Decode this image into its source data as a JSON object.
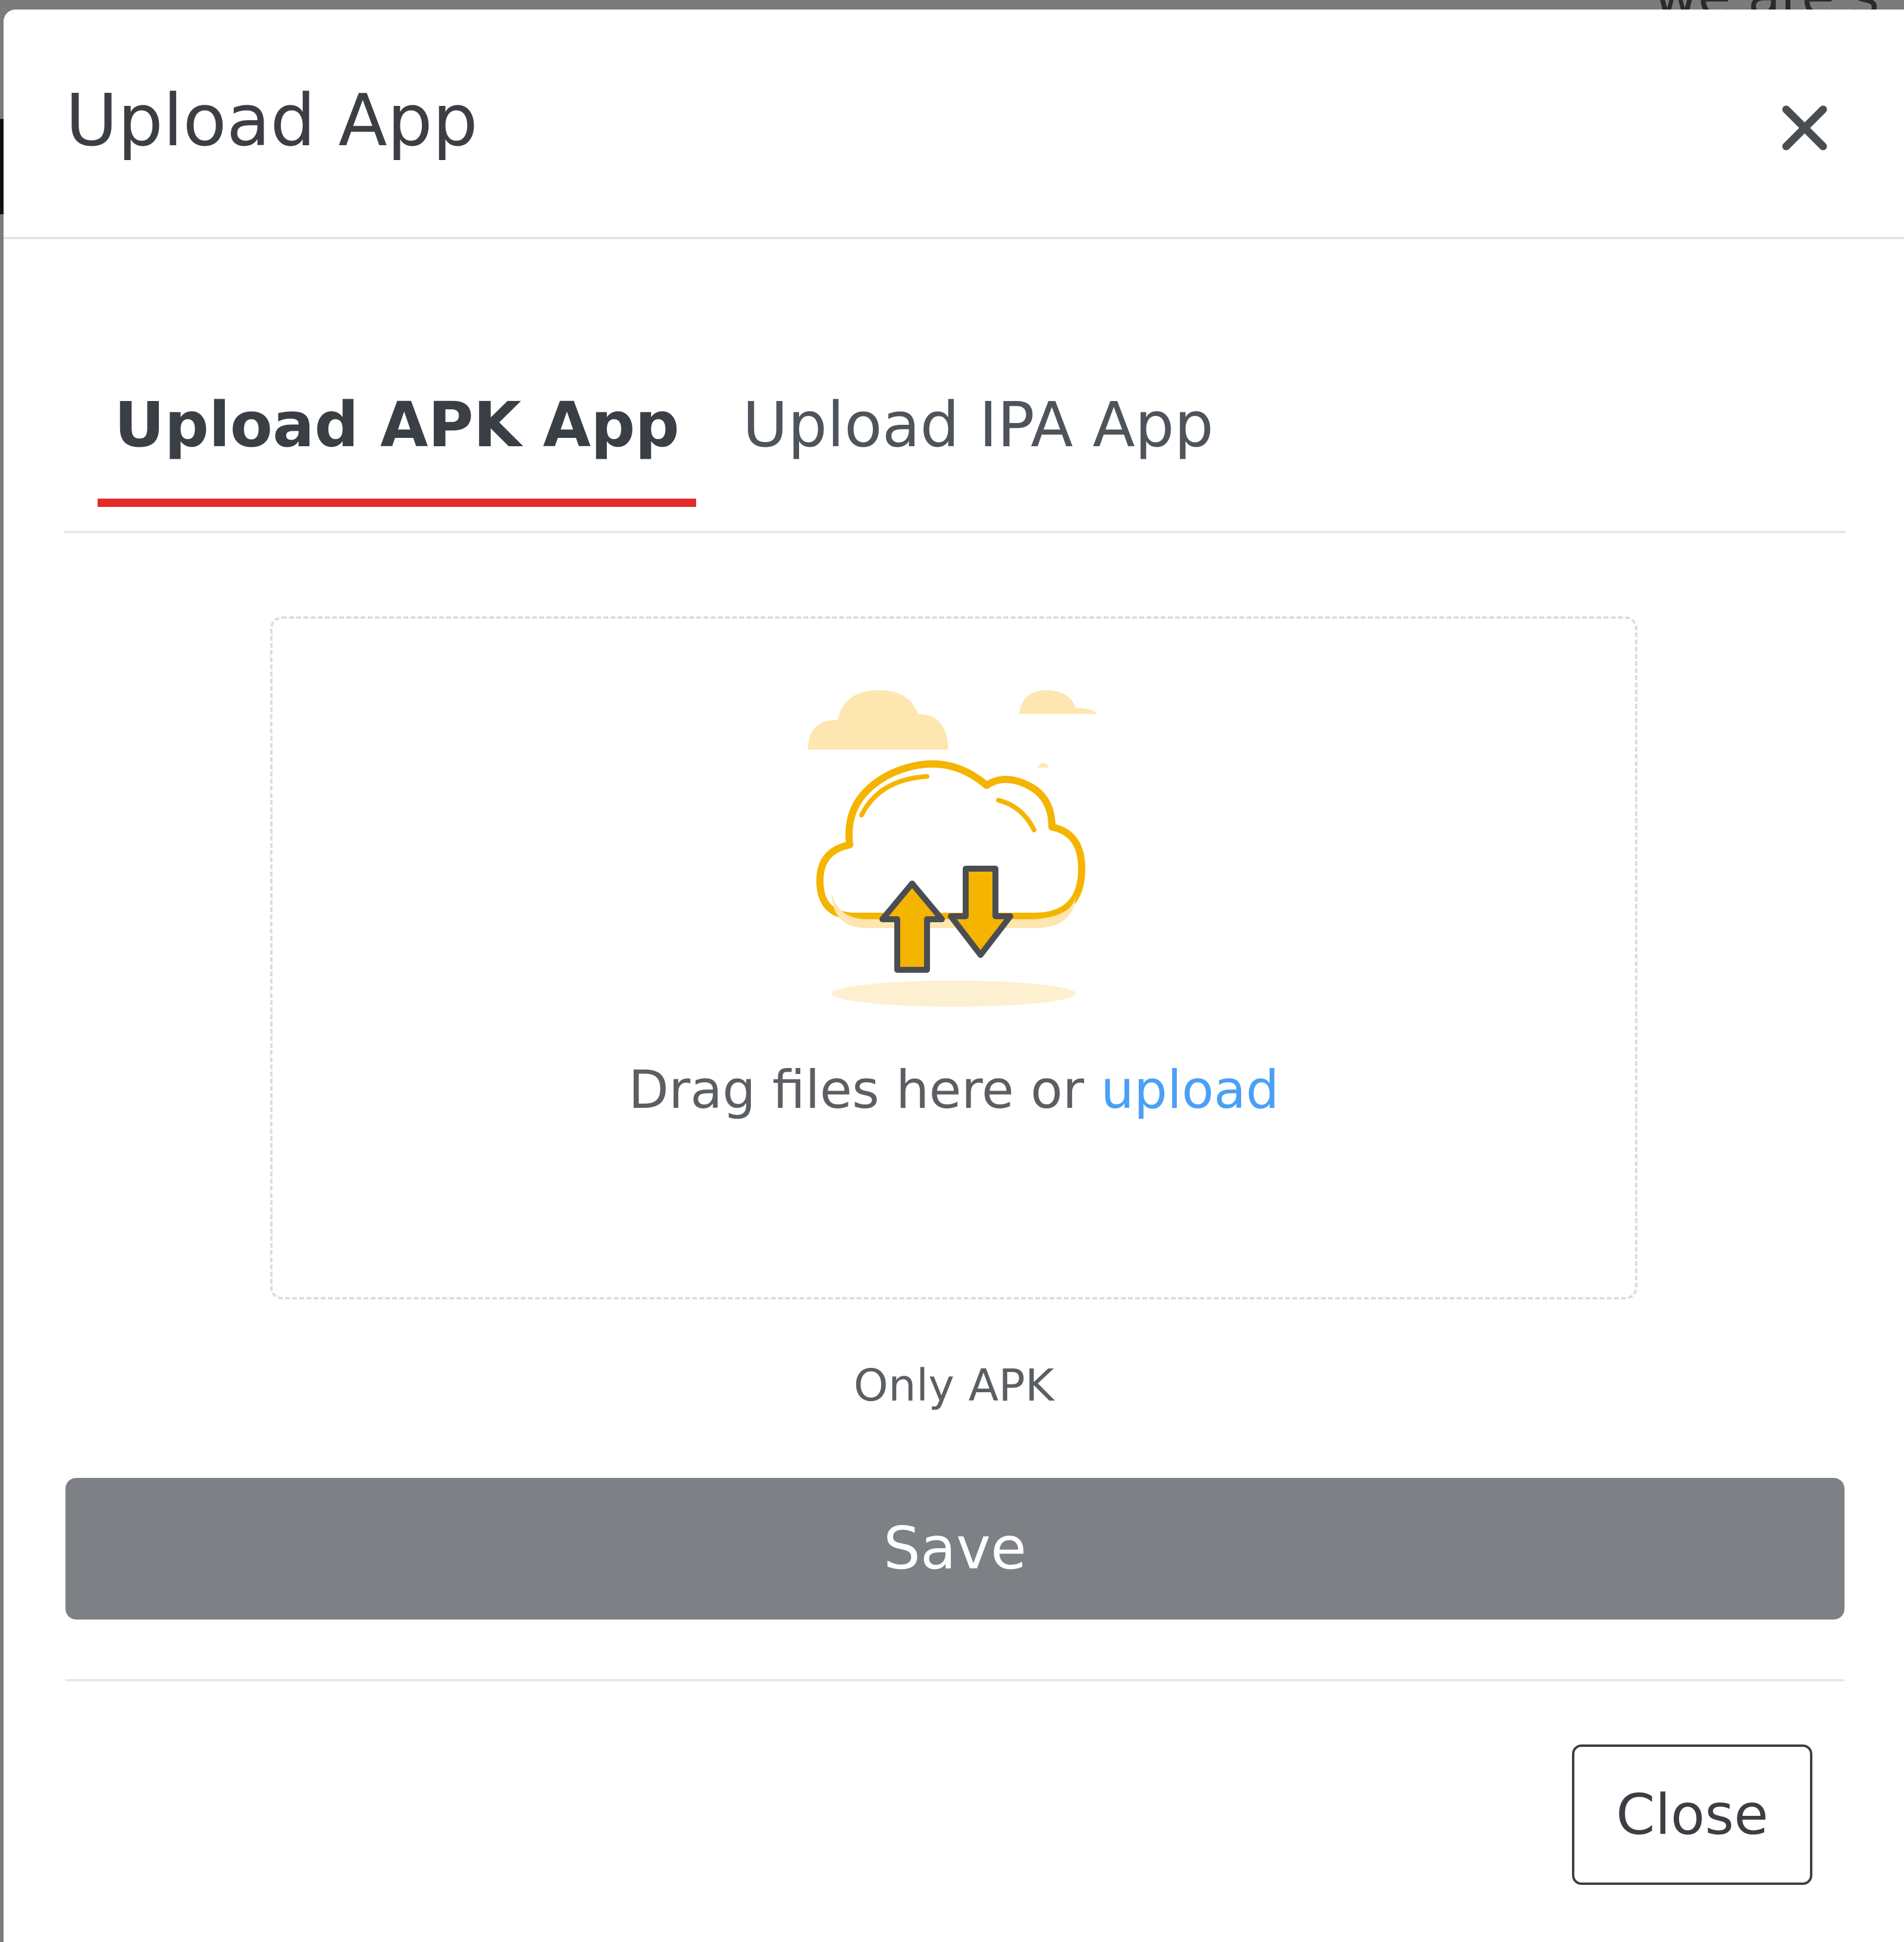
{
  "background": {
    "partial_text": "we are s"
  },
  "modal": {
    "title": "Upload App",
    "close_icon": "close-icon"
  },
  "tabs": [
    {
      "label": "Upload APK App",
      "active": true
    },
    {
      "label": "Upload IPA App",
      "active": false
    }
  ],
  "dropzone": {
    "illustration": "cloud-upload-icon",
    "text": "Drag files here or ",
    "link_text": "upload",
    "hint": "Only APK"
  },
  "buttons": {
    "save": "Save",
    "close": "Close"
  },
  "colors": {
    "active_tab_underline": "#e52a2a",
    "link": "#4aa0f5",
    "save_button": "#7d8084",
    "illustration_yellow": "#f5b400"
  }
}
